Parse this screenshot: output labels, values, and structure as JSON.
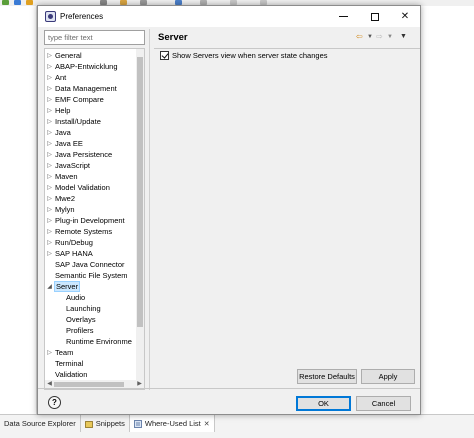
{
  "window": {
    "title": "Preferences"
  },
  "filter": {
    "placeholder": "type filter text"
  },
  "tree": {
    "items": [
      {
        "label": "General",
        "level": 0,
        "expandable": true,
        "expanded": false
      },
      {
        "label": "ABAP-Entwicklung",
        "level": 0,
        "expandable": true,
        "expanded": false
      },
      {
        "label": "Ant",
        "level": 0,
        "expandable": true,
        "expanded": false
      },
      {
        "label": "Data Management",
        "level": 0,
        "expandable": true,
        "expanded": false
      },
      {
        "label": "EMF Compare",
        "level": 0,
        "expandable": true,
        "expanded": false
      },
      {
        "label": "Help",
        "level": 0,
        "expandable": true,
        "expanded": false
      },
      {
        "label": "Install/Update",
        "level": 0,
        "expandable": true,
        "expanded": false
      },
      {
        "label": "Java",
        "level": 0,
        "expandable": true,
        "expanded": false
      },
      {
        "label": "Java EE",
        "level": 0,
        "expandable": true,
        "expanded": false
      },
      {
        "label": "Java Persistence",
        "level": 0,
        "expandable": true,
        "expanded": false
      },
      {
        "label": "JavaScript",
        "level": 0,
        "expandable": true,
        "expanded": false
      },
      {
        "label": "Maven",
        "level": 0,
        "expandable": true,
        "expanded": false
      },
      {
        "label": "Model Validation",
        "level": 0,
        "expandable": true,
        "expanded": false
      },
      {
        "label": "Mwe2",
        "level": 0,
        "expandable": true,
        "expanded": false
      },
      {
        "label": "Mylyn",
        "level": 0,
        "expandable": true,
        "expanded": false
      },
      {
        "label": "Plug-in Development",
        "level": 0,
        "expandable": true,
        "expanded": false
      },
      {
        "label": "Remote Systems",
        "level": 0,
        "expandable": true,
        "expanded": false
      },
      {
        "label": "Run/Debug",
        "level": 0,
        "expandable": true,
        "expanded": false
      },
      {
        "label": "SAP HANA",
        "level": 0,
        "expandable": true,
        "expanded": false
      },
      {
        "label": "SAP Java Connector",
        "level": 0,
        "expandable": false,
        "expanded": false
      },
      {
        "label": "Semantic File System",
        "level": 0,
        "expandable": false,
        "expanded": false
      },
      {
        "label": "Server",
        "level": 0,
        "expandable": true,
        "expanded": true,
        "selected": true
      },
      {
        "label": "Audio",
        "level": 1,
        "expandable": false,
        "expanded": false
      },
      {
        "label": "Launching",
        "level": 1,
        "expandable": false,
        "expanded": false
      },
      {
        "label": "Overlays",
        "level": 1,
        "expandable": false,
        "expanded": false
      },
      {
        "label": "Profilers",
        "level": 1,
        "expandable": false,
        "expanded": false
      },
      {
        "label": "Runtime Environme",
        "level": 1,
        "expandable": false,
        "expanded": false
      },
      {
        "label": "Team",
        "level": 0,
        "expandable": true,
        "expanded": false
      },
      {
        "label": "Terminal",
        "level": 0,
        "expandable": false,
        "expanded": false
      },
      {
        "label": "Validation",
        "level": 0,
        "expandable": false,
        "expanded": false
      }
    ]
  },
  "page": {
    "title": "Server",
    "checkbox_label": "Show Servers view when server state changes",
    "checkbox_checked": true
  },
  "buttons": {
    "restore_defaults": "Restore Defaults",
    "apply": "Apply",
    "ok": "OK",
    "cancel": "Cancel",
    "help": "?"
  },
  "ide_tabs": [
    {
      "label": "Data Source Explorer",
      "active": false
    },
    {
      "label": "Snippets",
      "active": false
    },
    {
      "label": "Where-Used List",
      "active": true
    }
  ],
  "colors": {
    "selection_bg": "#cce8ff",
    "default_button_border": "#0078d7",
    "back_arrow": "#d28a1d"
  }
}
